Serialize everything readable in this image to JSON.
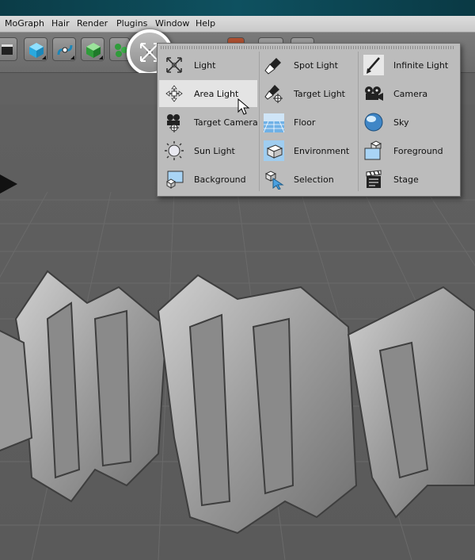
{
  "menu": {
    "items": [
      "MoGraph",
      "Hair",
      "Render",
      "Plugins",
      "Window",
      "Help"
    ]
  },
  "toolbar": {
    "buttons": [
      "cube-icon",
      "spline-icon",
      "nurbs-icon",
      "mograph-icon",
      "light-icon"
    ],
    "highlighted": "light-icon"
  },
  "popup": {
    "col1": [
      {
        "label": "Light",
        "icon": "light-icon"
      },
      {
        "label": "Area Light",
        "icon": "area-light-icon",
        "active": true
      },
      {
        "label": "Target Camera",
        "icon": "target-camera-icon"
      },
      {
        "label": "Sun Light",
        "icon": "sun-light-icon"
      },
      {
        "label": "Background",
        "icon": "background-icon"
      }
    ],
    "col2": [
      {
        "label": "Spot Light",
        "icon": "spot-light-icon"
      },
      {
        "label": "Target Light",
        "icon": "target-light-icon"
      },
      {
        "label": "Floor",
        "icon": "floor-icon"
      },
      {
        "label": "Environment",
        "icon": "environment-icon"
      },
      {
        "label": "Selection",
        "icon": "selection-icon"
      }
    ],
    "col3": [
      {
        "label": "Infinite Light",
        "icon": "infinite-light-icon"
      },
      {
        "label": "Camera",
        "icon": "camera-icon"
      },
      {
        "label": "Sky",
        "icon": "sky-icon"
      },
      {
        "label": "Foreground",
        "icon": "foreground-icon"
      },
      {
        "label": "Stage",
        "icon": "stage-icon"
      }
    ]
  },
  "colors": {
    "accent_titlebar": "#0e5160",
    "popup_bg": "#bcbcbc",
    "viewport_bg": "#5c5c5c"
  }
}
